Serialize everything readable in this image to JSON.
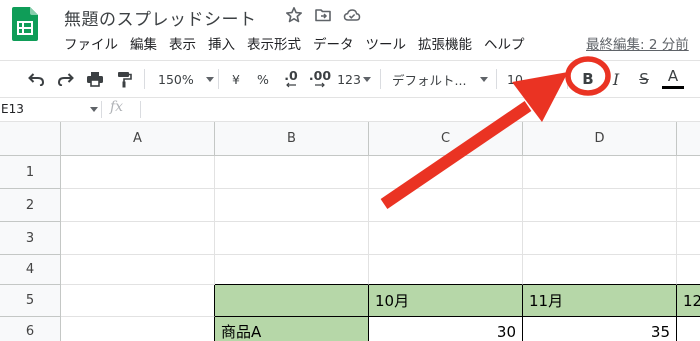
{
  "app": {
    "doc_title": "無題のスプレッドシート",
    "logo_icon": "google-sheets-logo",
    "title_icons": [
      "star-icon",
      "move-to-folder-icon",
      "cloud-saved-icon"
    ]
  },
  "menubar": {
    "items": [
      "ファイル",
      "編集",
      "表示",
      "挿入",
      "表示形式",
      "データ",
      "ツール",
      "拡張機能",
      "ヘルプ"
    ],
    "last_edit": "最終編集: 2 分前"
  },
  "toolbar": {
    "zoom": "150%",
    "currency": "¥",
    "percent": "%",
    "decrease_decimal": ".0",
    "increase_decimal": ".00",
    "number_format": "123",
    "font_family": "デフォルト...",
    "font_size": "10",
    "bold": "B",
    "italic": "I",
    "strikethrough": "S",
    "text_color": "A",
    "text_color_underline": "#000000"
  },
  "formula_bar": {
    "name_box": "E13",
    "fx": "fx",
    "content": ""
  },
  "grid": {
    "columns": [
      "A",
      "B",
      "C",
      "D"
    ],
    "rows": [
      "1",
      "2",
      "3",
      "4",
      "5",
      "6"
    ],
    "header_fill": "#b6d7a8",
    "row5": {
      "B": "",
      "C": "10月",
      "D": "11月",
      "E": "12"
    },
    "row6": {
      "B": "商品A",
      "C": "30",
      "D": "35",
      "E": ""
    }
  },
  "annotation": {
    "arrow_color": "#ea3323",
    "highlight_target": "bold-button"
  }
}
